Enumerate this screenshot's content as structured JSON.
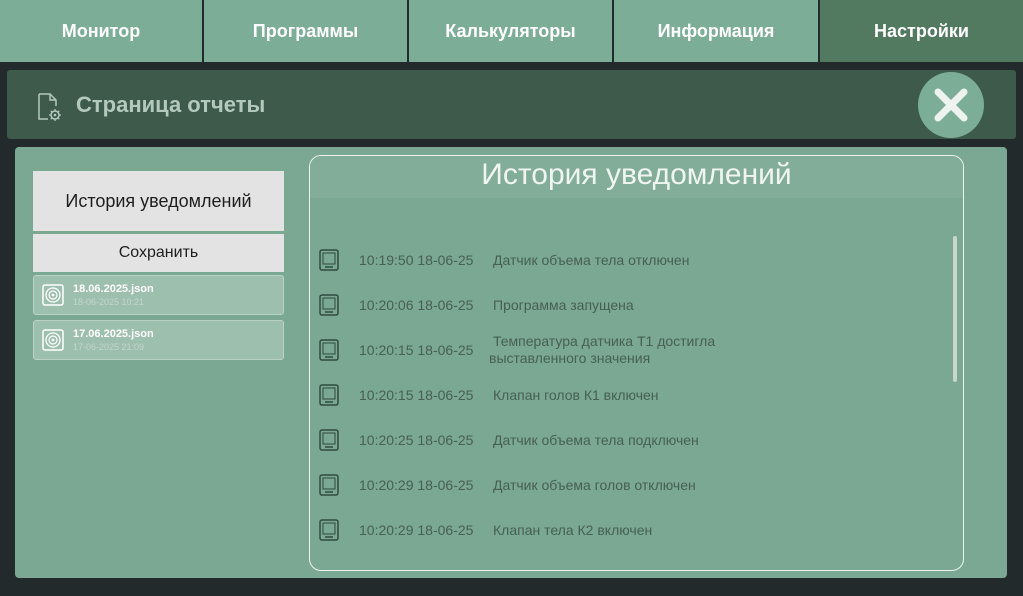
{
  "nav": {
    "tabs": [
      {
        "label": "Монитор"
      },
      {
        "label": "Программы"
      },
      {
        "label": "Калькуляторы"
      },
      {
        "label": "Информация"
      },
      {
        "label": "Настройки"
      }
    ]
  },
  "header": {
    "title": "Страница отчеты"
  },
  "sidebar": {
    "history_label": "История уведомлений",
    "save_label": "Сохранить",
    "files": [
      {
        "name": "18.06.2025.json",
        "date": "18-06-2025 10:21"
      },
      {
        "name": "17.06.2025.json",
        "date": "17-06-2025 21:09"
      }
    ]
  },
  "notifications": {
    "title": "История уведомлений",
    "items": [
      {
        "time": "10:19:50 18-06-25",
        "message": "Датчик объема тела отключен"
      },
      {
        "time": "10:20:06 18-06-25",
        "message": "Программа запущена"
      },
      {
        "time": "10:20:15 18-06-25",
        "message": "Температура датчика Т1 достигла выставленного значения"
      },
      {
        "time": "10:20:15 18-06-25",
        "message": "Клапан голов К1 включен"
      },
      {
        "time": "10:20:25 18-06-25",
        "message": "Датчик объема тела подключен"
      },
      {
        "time": "10:20:29 18-06-25",
        "message": "Датчик объема голов отключен"
      },
      {
        "time": "10:20:29 18-06-25",
        "message": "Клапан тела К2 включен"
      }
    ]
  },
  "colors": {
    "tab": "#7cae97",
    "tab_active": "#527a61",
    "header_bar": "#3d5a4b",
    "panel": "#7aa892",
    "background": "#232a2b"
  }
}
